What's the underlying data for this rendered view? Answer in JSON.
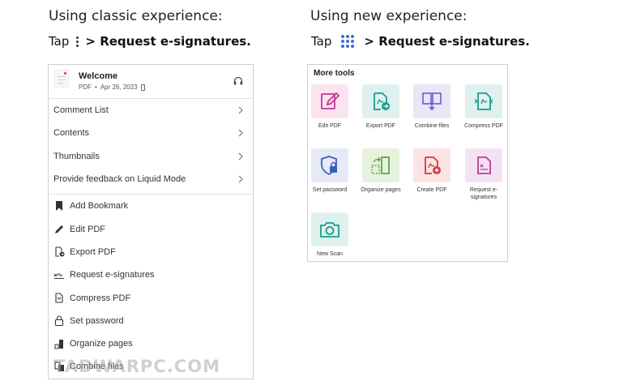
{
  "headings": {
    "classic": "Using classic experience:",
    "new": "Using new experience:"
  },
  "instructions": {
    "tap": "Tap",
    "classic_action": "> Request e-signatures.",
    "new_action": "> Request e-signatures."
  },
  "classic_panel": {
    "file": {
      "name": "Welcome",
      "type": "PDF",
      "dot": "•",
      "date": "Apr 26, 2023"
    },
    "menu_items": [
      {
        "label": "Comment List"
      },
      {
        "label": "Contents"
      },
      {
        "label": "Thumbnails"
      },
      {
        "label": "Provide feedback on Liquid Mode"
      }
    ],
    "tool_items": [
      {
        "label": "Add Bookmark",
        "icon": "bookmark-icon"
      },
      {
        "label": "Edit PDF",
        "icon": "pencil-icon"
      },
      {
        "label": "Export PDF",
        "icon": "export-pdf-icon"
      },
      {
        "label": "Request e-signatures",
        "icon": "signature-icon"
      },
      {
        "label": "Compress PDF",
        "icon": "compress-icon"
      },
      {
        "label": "Set password",
        "icon": "lock-icon"
      },
      {
        "label": "Organize pages",
        "icon": "organize-icon"
      },
      {
        "label": "Combine files",
        "icon": "combine-icon"
      }
    ]
  },
  "new_panel": {
    "title": "More tools",
    "tools": [
      {
        "label": "Edit PDF",
        "icon": "edit-pdf-icon",
        "color": "#fbe4ef"
      },
      {
        "label": "Export PDF",
        "icon": "export-pdf-icon",
        "color": "#dff1ef"
      },
      {
        "label": "Combine files",
        "icon": "combine-files-icon",
        "color": "#e8e6f7"
      },
      {
        "label": "Compress PDF",
        "icon": "compress-pdf-icon",
        "color": "#dff1ef"
      },
      {
        "label": "Set password",
        "icon": "set-password-icon",
        "color": "#e6eaf7"
      },
      {
        "label": "Organize pages",
        "icon": "organize-pages-icon",
        "color": "#e7f3df"
      },
      {
        "label": "Create PDF",
        "icon": "create-pdf-icon",
        "color": "#fbe4e4"
      },
      {
        "label": "Request e-signatures",
        "icon": "request-esign-icon",
        "color": "#f4e2f3"
      },
      {
        "label": "New Scan",
        "icon": "camera-icon",
        "color": "#dff1ef"
      }
    ]
  },
  "watermark": "TADWARPC.COM",
  "colors": {
    "accent_blue": "#3b6fd4",
    "teal": "#1a9c8c",
    "magenta": "#c2379a",
    "red": "#d7373f",
    "purple": "#6b5bd2",
    "green": "#5aa845"
  }
}
